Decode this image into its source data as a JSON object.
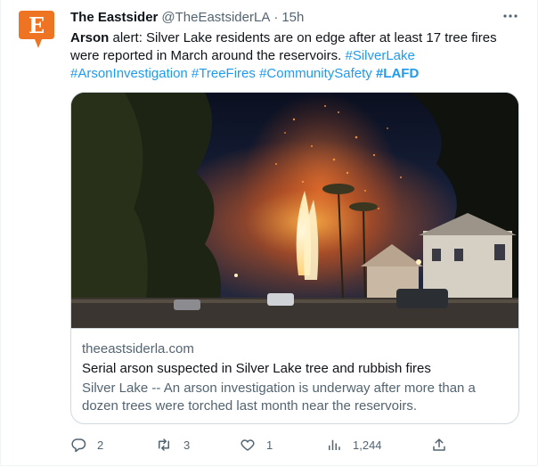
{
  "tweet": {
    "author_name": "The Eastsider",
    "handle": "@TheEastsiderLA",
    "separator": "·",
    "time": "15h",
    "avatar_letter": "E",
    "text_bold": "Arson",
    "text_plain": " alert:  Silver Lake residents are on edge after at least 17 tree fires were reported in March around the reservoirs. ",
    "hashtags": [
      "#SilverLake",
      "#ArsonInvestigation",
      "#TreeFires",
      "#CommunitySafety"
    ],
    "hashtag_bold": "#LAFD"
  },
  "card": {
    "domain": "theeastsiderla.com",
    "title": "Serial arson suspected in Silver Lake tree and rubbish fires",
    "description": "Silver Lake -- An arson investigation is underway after more than a dozen trees were torched last month near the reservoirs."
  },
  "actions": {
    "replies": "2",
    "retweets": "3",
    "likes": "1",
    "views": "1,244"
  },
  "colors": {
    "brand_orange": "#ee7423",
    "link_blue": "#1d9bf0",
    "text_secondary": "#536471"
  },
  "icons": [
    "more-icon",
    "reply-icon",
    "retweet-icon",
    "like-icon",
    "views-icon",
    "share-icon"
  ]
}
